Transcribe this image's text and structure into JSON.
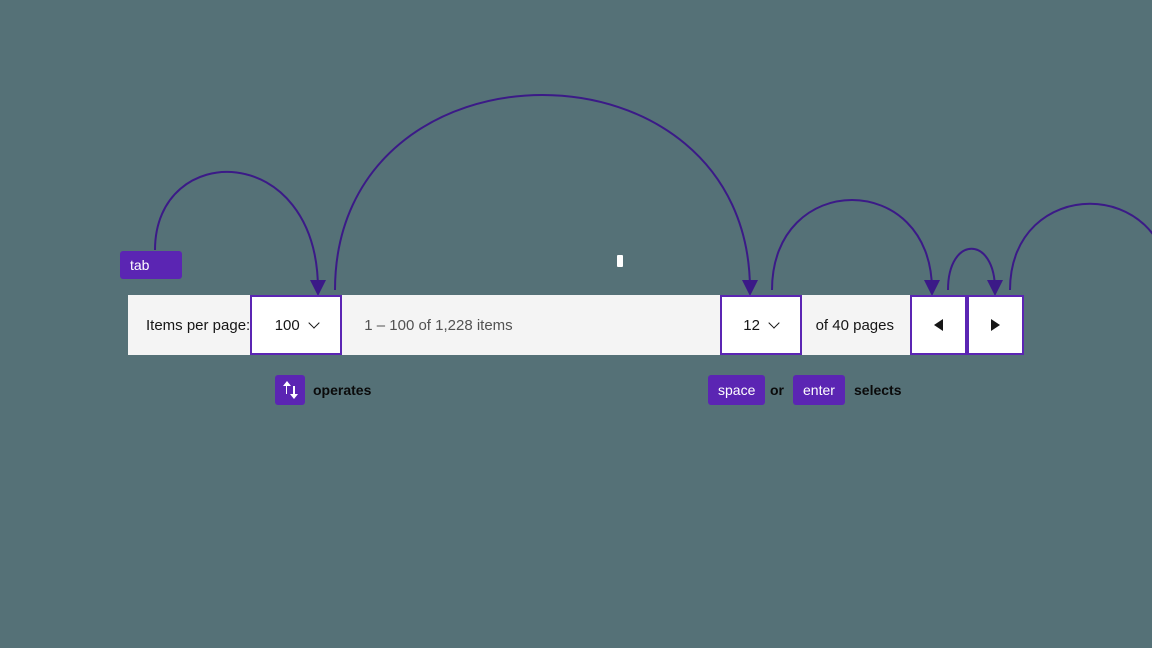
{
  "colors": {
    "accent": "#5b25b3",
    "bg": "#557177",
    "bar": "#f4f4f4"
  },
  "keys": {
    "tab": "tab",
    "space": "space",
    "enter": "enter"
  },
  "hints": {
    "operates": "operates",
    "or": "or",
    "selects": "selects"
  },
  "pagination": {
    "items_per_page_label": "Items per page:",
    "items_per_page_value": "100",
    "range_text": "1 – 100 of 1,228 items",
    "page_value": "12",
    "of_pages_text": "of 40 pages"
  }
}
